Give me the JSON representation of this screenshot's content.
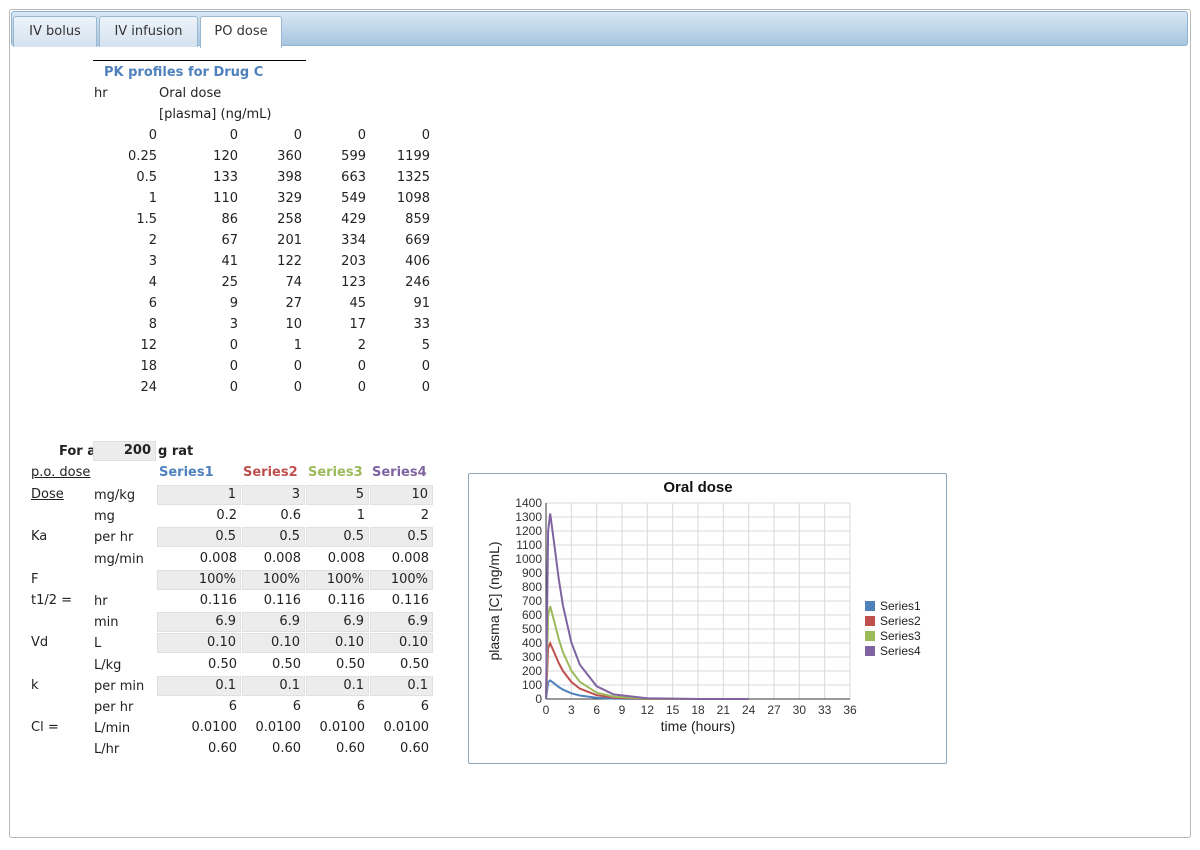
{
  "tabs": [
    {
      "label": "IV bolus",
      "active": false
    },
    {
      "label": "IV infusion",
      "active": false
    },
    {
      "label": "PO dose",
      "active": true
    }
  ],
  "pk_table": {
    "title": "PK profiles for Drug C",
    "col_hr": "hr",
    "col_oral": "Oral dose",
    "col_units": "[plasma] (ng/mL)",
    "rows": [
      [
        "0",
        "0",
        "0",
        "0",
        "0"
      ],
      [
        "0.25",
        "120",
        "360",
        "599",
        "1199"
      ],
      [
        "0.5",
        "133",
        "398",
        "663",
        "1325"
      ],
      [
        "1",
        "110",
        "329",
        "549",
        "1098"
      ],
      [
        "1.5",
        "86",
        "258",
        "429",
        "859"
      ],
      [
        "2",
        "67",
        "201",
        "334",
        "669"
      ],
      [
        "3",
        "41",
        "122",
        "203",
        "406"
      ],
      [
        "4",
        "25",
        "74",
        "123",
        "246"
      ],
      [
        "6",
        "9",
        "27",
        "45",
        "91"
      ],
      [
        "8",
        "3",
        "10",
        "17",
        "33"
      ],
      [
        "12",
        "0",
        "1",
        "2",
        "5"
      ],
      [
        "18",
        "0",
        "0",
        "0",
        "0"
      ],
      [
        "24",
        "0",
        "0",
        "0",
        "0"
      ]
    ]
  },
  "params": {
    "for_a": "For a",
    "rat_weight": "200",
    "g_rat": "g rat",
    "po_dose": "p.o. dose",
    "series_headers": [
      {
        "label": "Series1",
        "color": "#4f81bd"
      },
      {
        "label": "Series2",
        "color": "#c0504d"
      },
      {
        "label": "Series3",
        "color": "#9bbb59"
      },
      {
        "label": "Series4",
        "color": "#8064a2"
      }
    ],
    "rows": [
      {
        "name": "Dose",
        "unit": "mg/kg",
        "input": true,
        "values": [
          "1",
          "3",
          "5",
          "10"
        ]
      },
      {
        "name": "",
        "unit": "mg",
        "input": false,
        "values": [
          "0.2",
          "0.6",
          "1",
          "2"
        ]
      },
      {
        "name": "Ka",
        "unit": "per hr",
        "input": true,
        "values": [
          "0.5",
          "0.5",
          "0.5",
          "0.5"
        ]
      },
      {
        "name": "",
        "unit": "mg/min",
        "input": false,
        "values": [
          "0.008",
          "0.008",
          "0.008",
          "0.008"
        ]
      },
      {
        "name": "F",
        "unit": "",
        "input": true,
        "values": [
          "100%",
          "100%",
          "100%",
          "100%"
        ]
      },
      {
        "name": "t1/2 =",
        "unit": "hr",
        "input": false,
        "values": [
          "0.116",
          "0.116",
          "0.116",
          "0.116"
        ]
      },
      {
        "name": "",
        "unit": "min",
        "input": true,
        "values": [
          "6.9",
          "6.9",
          "6.9",
          "6.9"
        ]
      },
      {
        "name": "Vd",
        "unit": "L",
        "input": true,
        "values": [
          "0.10",
          "0.10",
          "0.10",
          "0.10"
        ]
      },
      {
        "name": "",
        "unit": "L/kg",
        "input": false,
        "values": [
          "0.50",
          "0.50",
          "0.50",
          "0.50"
        ]
      },
      {
        "name": "k",
        "unit": "per min",
        "input": true,
        "values": [
          "0.1",
          "0.1",
          "0.1",
          "0.1"
        ]
      },
      {
        "name": "",
        "unit": "per hr",
        "input": false,
        "values": [
          "6",
          "6",
          "6",
          "6"
        ]
      },
      {
        "name": "Cl =",
        "unit": "L/min",
        "input": false,
        "values": [
          "0.0100",
          "0.0100",
          "0.0100",
          "0.0100"
        ]
      },
      {
        "name": "",
        "unit": "L/hr",
        "input": false,
        "values": [
          "0.60",
          "0.60",
          "0.60",
          "0.60"
        ]
      }
    ]
  },
  "chart_data": {
    "type": "line",
    "title": "Oral dose",
    "xlabel": "time (hours)",
    "ylabel": "plasma [C] (ng/mL)",
    "xlim": [
      0,
      36
    ],
    "ylim": [
      0,
      1400
    ],
    "xticks": [
      0,
      3,
      6,
      9,
      12,
      15,
      18,
      21,
      24,
      27,
      30,
      33,
      36
    ],
    "yticks": [
      0,
      100,
      200,
      300,
      400,
      500,
      600,
      700,
      800,
      900,
      1000,
      1100,
      1200,
      1300,
      1400
    ],
    "grid": true,
    "legend_position": "right",
    "x": [
      0,
      0.25,
      0.5,
      1,
      1.5,
      2,
      3,
      4,
      6,
      8,
      12,
      18,
      24
    ],
    "series": [
      {
        "name": "Series1",
        "color": "#4f81bd",
        "values": [
          0,
          120,
          133,
          110,
          86,
          67,
          41,
          25,
          9,
          3,
          0,
          0,
          0
        ]
      },
      {
        "name": "Series2",
        "color": "#c0504d",
        "values": [
          0,
          360,
          398,
          329,
          258,
          201,
          122,
          74,
          27,
          10,
          1,
          0,
          0
        ]
      },
      {
        "name": "Series3",
        "color": "#9bbb59",
        "values": [
          0,
          599,
          663,
          549,
          429,
          334,
          203,
          123,
          45,
          17,
          2,
          0,
          0
        ]
      },
      {
        "name": "Series4",
        "color": "#8064a2",
        "values": [
          0,
          1199,
          1325,
          1098,
          859,
          669,
          406,
          246,
          91,
          33,
          5,
          0,
          0
        ]
      }
    ]
  }
}
